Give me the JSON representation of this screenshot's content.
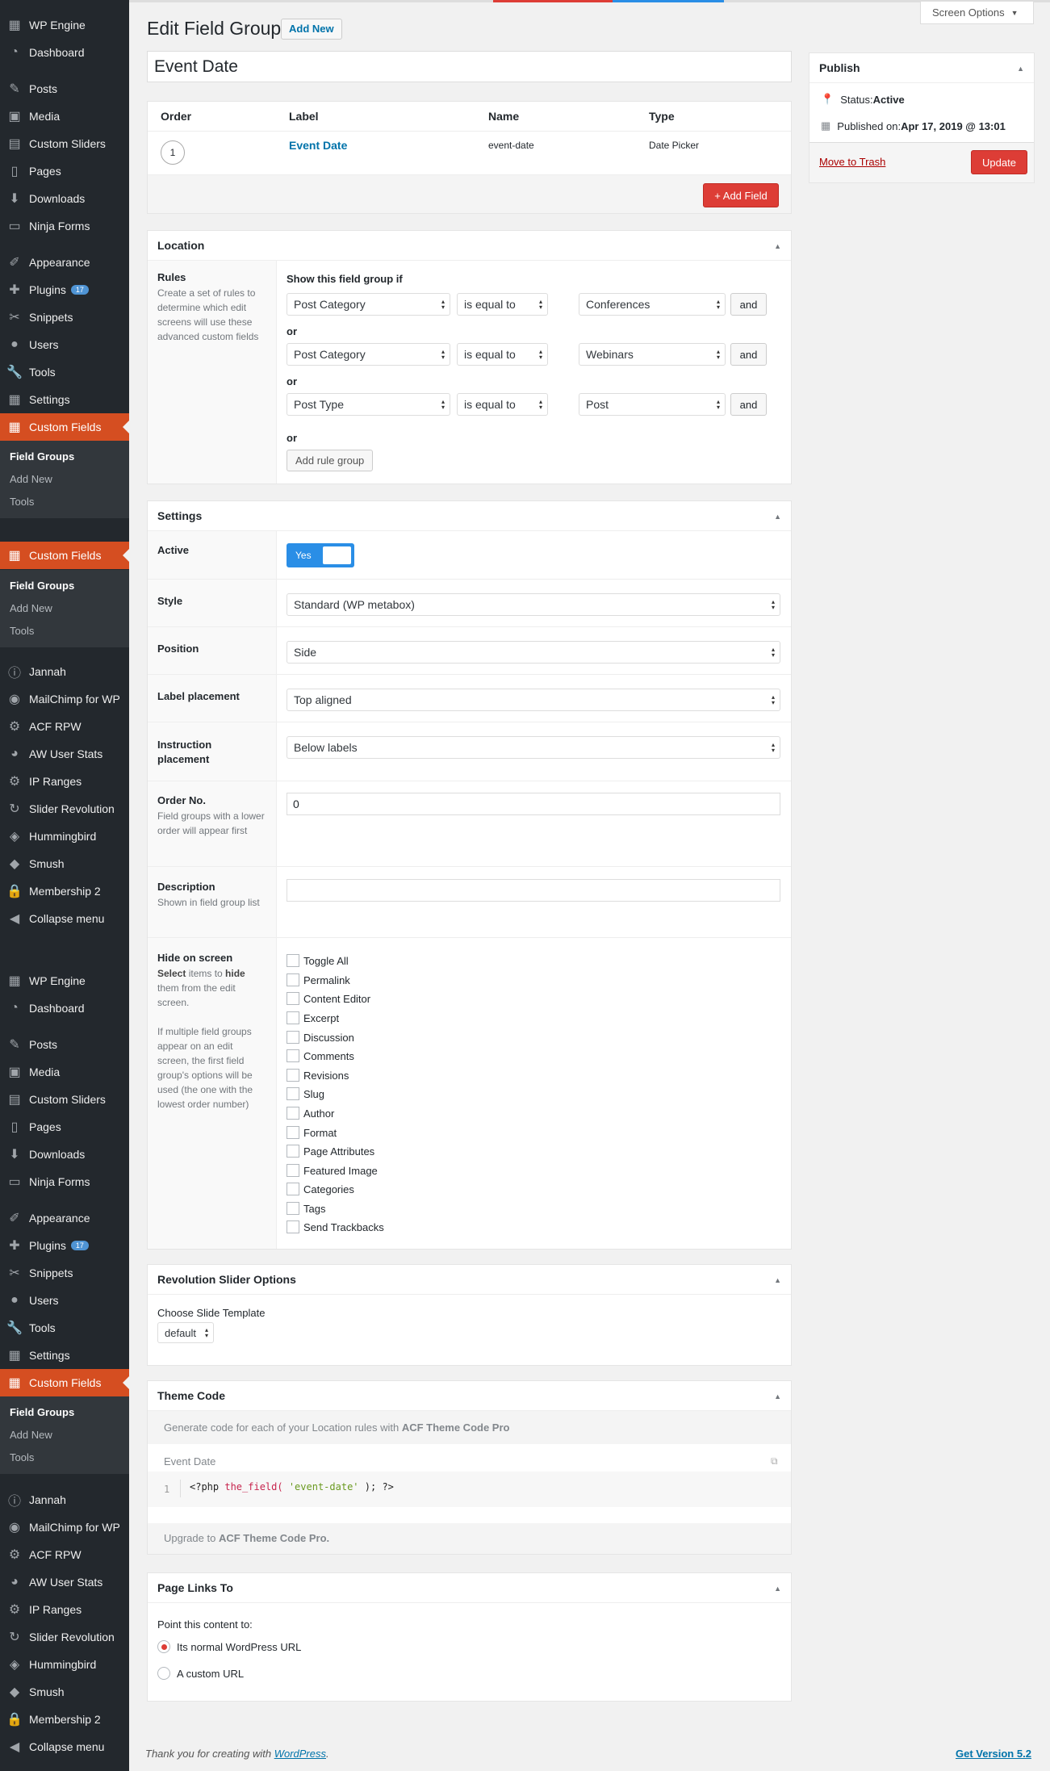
{
  "sidebar": {
    "main_menu": [
      {
        "label": "WP Engine",
        "icon": "wpengine-icon"
      },
      {
        "label": "Dashboard",
        "icon": "dashboard-icon"
      },
      {
        "label": "Posts",
        "icon": "pin-icon"
      },
      {
        "label": "Media",
        "icon": "media-icon"
      },
      {
        "label": "Custom Sliders",
        "icon": "slider-icon"
      },
      {
        "label": "Pages",
        "icon": "page-icon"
      },
      {
        "label": "Downloads",
        "icon": "download-icon"
      },
      {
        "label": "Ninja Forms",
        "icon": "form-icon"
      },
      {
        "label": "Appearance",
        "icon": "brush-icon"
      },
      {
        "label": "Plugins",
        "icon": "plugin-icon",
        "badge": "17"
      },
      {
        "label": "Snippets",
        "icon": "scissors-icon"
      },
      {
        "label": "Users",
        "icon": "user-icon"
      },
      {
        "label": "Tools",
        "icon": "wrench-icon"
      },
      {
        "label": "Settings",
        "icon": "settings-icon"
      },
      {
        "label": "Custom Fields",
        "icon": "fields-icon"
      }
    ],
    "submenu": [
      "Field Groups",
      "Add New",
      "Tools"
    ],
    "extra_menu": [
      {
        "label": "Jannah",
        "icon": "info-icon"
      },
      {
        "label": "MailChimp for WP",
        "icon": "mailchimp-icon"
      },
      {
        "label": "ACF RPW",
        "icon": "gear-icon"
      },
      {
        "label": "AW User Stats",
        "icon": "chart-icon"
      },
      {
        "label": "IP Ranges",
        "icon": "gear-icon"
      },
      {
        "label": "Slider Revolution",
        "icon": "refresh-icon"
      },
      {
        "label": "Hummingbird",
        "icon": "bird-icon"
      },
      {
        "label": "Smush",
        "icon": "smush-icon"
      },
      {
        "label": "Membership 2",
        "icon": "lock-icon"
      },
      {
        "label": "Collapse menu",
        "icon": "collapse-icon"
      }
    ]
  },
  "header": {
    "title": "Edit Field Group",
    "add_new": "Add New",
    "screen_options": "Screen Options"
  },
  "title_input": "Event Date",
  "fields_table": {
    "headers": [
      "Order",
      "Label",
      "Name",
      "Type"
    ],
    "row": {
      "order": "1",
      "label": "Event Date",
      "name": "event-date",
      "type": "Date Picker"
    },
    "add_field": "+ Add Field"
  },
  "location": {
    "title": "Location",
    "rules_label": "Rules",
    "rules_desc": "Create a set of rules to determine which edit screens will use these advanced custom fields",
    "heading": "Show this field group if",
    "groups": [
      {
        "param": "Post Category",
        "operator": "is equal to",
        "value": "Conferences",
        "and": "and"
      },
      {
        "param": "Post Category",
        "operator": "is equal to",
        "value": "Webinars",
        "and": "and"
      },
      {
        "param": "Post Type",
        "operator": "is equal to",
        "value": "Post",
        "and": "and"
      }
    ],
    "or": "or",
    "add_rule_group": "Add rule group"
  },
  "settings": {
    "title": "Settings",
    "active_label": "Active",
    "active_value": "Yes",
    "style_label": "Style",
    "style_value": "Standard (WP metabox)",
    "position_label": "Position",
    "position_value": "Side",
    "label_placement_label": "Label placement",
    "label_placement_value": "Top aligned",
    "instruction_label": "Instruction placement",
    "instruction_value": "Below labels",
    "order_label": "Order No.",
    "order_desc": "Field groups with a lower order will appear first",
    "order_value": "0",
    "desc_label": "Description",
    "desc_desc": "Shown in field group list",
    "desc_value": "",
    "hide_label": "Hide on screen",
    "hide_desc_select": "Select",
    "hide_desc_mid": " items to ",
    "hide_desc_hide": "hide",
    "hide_desc_end": " them from the edit screen.",
    "hide_desc2": "If multiple field groups appear on an edit screen, the first field group's options will be used (the one with the lowest order number)",
    "hide_items": [
      "Toggle All",
      "Permalink",
      "Content Editor",
      "Excerpt",
      "Discussion",
      "Comments",
      "Revisions",
      "Slug",
      "Author",
      "Format",
      "Page Attributes",
      "Featured Image",
      "Categories",
      "Tags",
      "Send Trackbacks"
    ]
  },
  "revslider": {
    "title": "Revolution Slider Options",
    "label": "Choose Slide Template",
    "value": "default"
  },
  "theme_code": {
    "title": "Theme Code",
    "intro_pre": "Generate code for each of your Location rules with ",
    "intro_brand": "ACF Theme Code Pro",
    "field_label": "Event Date",
    "line_no": "1",
    "code_open": "<?php ",
    "code_fn": "the_field(",
    "code_arg": " 'event-date' ",
    "code_close": "); ?>",
    "upgrade_pre": "Upgrade to ",
    "upgrade_brand": "ACF Theme Code Pro."
  },
  "page_links": {
    "title": "Page Links To",
    "label": "Point this content to:",
    "opt1": "Its normal WordPress URL",
    "opt2": "A custom URL"
  },
  "publish": {
    "title": "Publish",
    "status_label": "Status: ",
    "status_value": "Active",
    "published_label": "Published on: ",
    "published_value": "Apr 17, 2019 @ 13:01",
    "trash": "Move to Trash",
    "update": "Update"
  },
  "footer": {
    "thanks_pre": "Thank you for creating with ",
    "thanks_link": "WordPress",
    "thanks_post": ".",
    "version": "Get Version 5.2"
  },
  "colors": {
    "sidebar": "#23282d",
    "accent_red": "#dd3d36",
    "link": "#0073aa",
    "toggle_blue": "#2a8ee6"
  }
}
